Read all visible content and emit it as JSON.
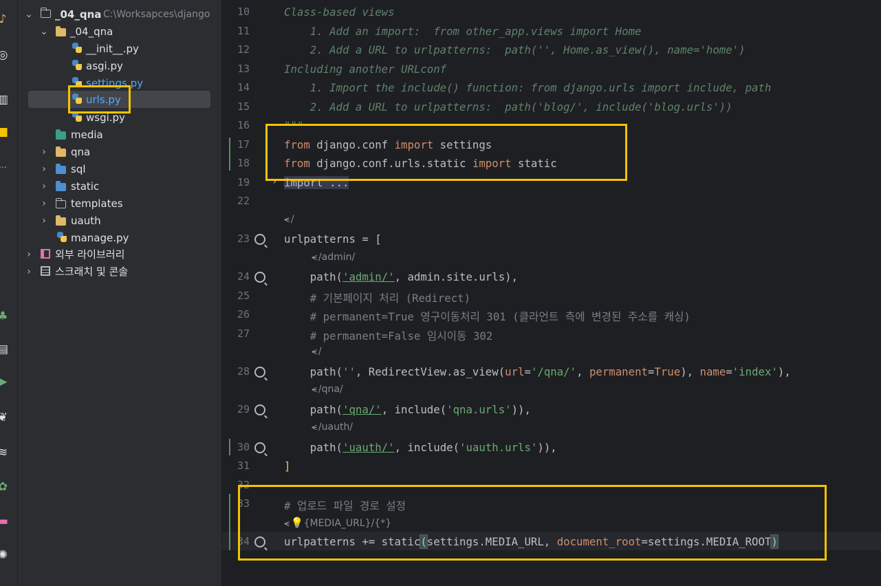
{
  "colors": {
    "highlight_box": "#f5c400",
    "panel_bg": "#2b2d30",
    "editor_bg": "#1e1f22"
  },
  "toolstrip": {
    "icons": [
      "project-icon",
      "git-icon",
      "structure-icon",
      "bookmarks-icon",
      "more-icon",
      "python-packages-icon",
      "services-icon",
      "run-icon",
      "python-console-icon",
      "layers-icon",
      "settings-icon",
      "terminal-icon",
      "problems-icon"
    ]
  },
  "project": {
    "root": {
      "label": "_04_qna",
      "path": "C:\\Worksapces\\django"
    },
    "items": [
      {
        "label": "_04_qna"
      },
      {
        "label": "__init__.py"
      },
      {
        "label": "asgi.py"
      },
      {
        "label": "settings.py"
      },
      {
        "label": "urls.py"
      },
      {
        "label": "wsgi.py"
      },
      {
        "label": "media"
      },
      {
        "label": "qna"
      },
      {
        "label": "sql"
      },
      {
        "label": "static"
      },
      {
        "label": "templates"
      },
      {
        "label": "uauth"
      },
      {
        "label": "manage.py"
      },
      {
        "label": "외부 라이브러리"
      },
      {
        "label": "스크래치 및 콘솔"
      }
    ]
  },
  "editor": {
    "line_numbers": [
      "10",
      "11",
      "12",
      "13",
      "14",
      "15",
      "16",
      "17",
      "18",
      "19",
      "22",
      "23",
      "24",
      "25",
      "26",
      "27",
      "28",
      "29",
      "30",
      "31",
      "32",
      "33",
      "34"
    ],
    "lines": {
      "l10": "Class-based views",
      "l11": "    1. Add an import:  from other_app.views import Home",
      "l12": "    2. Add a URL to urlpatterns:  path('', Home.as_view(), name='home')",
      "l13": "Including another URLconf",
      "l14": "    1. Import the include() function: from django.urls import include, path",
      "l15": "    2. Add a URL to urlpatterns:  path('blog/', include('blog.urls'))",
      "l16": "\"\"\"",
      "l17_kw1": "from",
      "l17_mod": " django.conf ",
      "l17_kw2": "import",
      "l17_name": " settings",
      "l18_kw1": "from",
      "l18_mod": " django.conf.urls.static ",
      "l18_kw2": "import",
      "l18_name": " static",
      "l19": "import ...",
      "l23": "urlpatterns = [",
      "l24_a": "    path(",
      "l24_s": "'admin/'",
      "l24_b": ", admin.site.urls),",
      "l25": "    # 기본페이지 처리 (Redirect)",
      "l26": "    # permanent=True 영구이동처리 301 (클라언트 측에 변경된 주소를 캐싱)",
      "l27": "    # permanent=False 임시이동 302",
      "l28_a": "    path(",
      "l28_s1": "''",
      "l28_b": ", RedirectView.as_view(",
      "l28_p1": "url",
      "l28_eq1": "=",
      "l28_s2": "'/qna/'",
      "l28_c1": ", ",
      "l28_p2": "permanent",
      "l28_eq2": "=",
      "l28_true": "True",
      "l28_c2": "), ",
      "l28_p3": "name",
      "l28_eq3": "=",
      "l28_s3": "'index'",
      "l28_end": "),",
      "l29_a": "    path(",
      "l29_s1": "'qna/'",
      "l29_b": ", include(",
      "l29_s2": "'qna.urls'",
      "l29_end": ")),",
      "l30_a": "    path(",
      "l30_s1": "'uauth/'",
      "l30_b": ", include(",
      "l30_s2": "'uauth.urls'",
      "l30_end": ")),",
      "l31": "]",
      "l33": "# 업로드 파일 경로 설정",
      "l34_a": "urlpatterns += static",
      "l34_paren": "(",
      "l34_b": "settings.MEDIA_URL, ",
      "l34_p": "document_root",
      "l34_c": "=settings.MEDIA_ROOT",
      "l34_paren2": ")"
    },
    "hints": {
      "h_root": "/",
      "h_admin": "/admin/",
      "h_index": "/",
      "h_qna": "/qna/",
      "h_uauth": "/uauth/",
      "h_media": "{MEDIA_URL}/{*}"
    }
  }
}
